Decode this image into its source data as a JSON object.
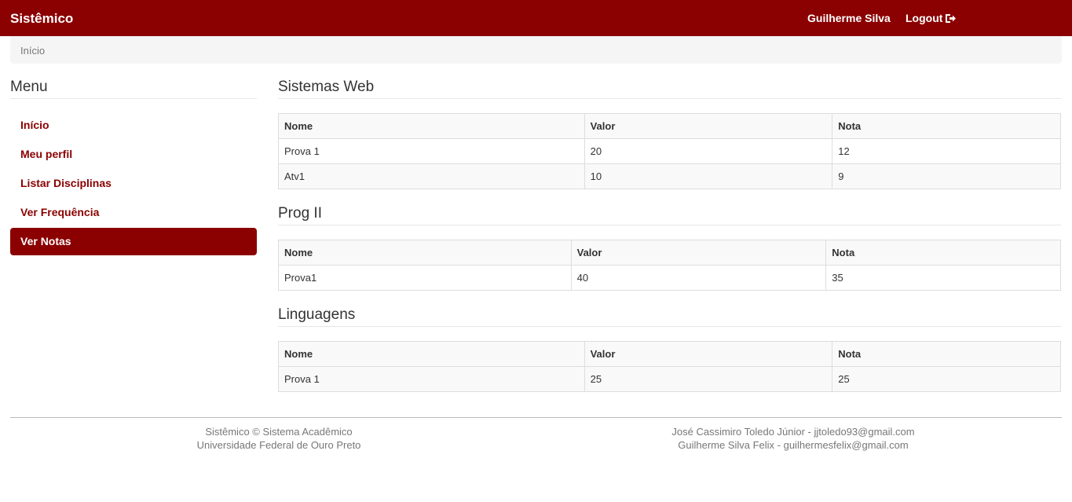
{
  "navbar": {
    "brand": "Sistêmico",
    "user": "Guilherme Silva",
    "logout": "Logout",
    "logout_icon": "logout-icon"
  },
  "breadcrumb": {
    "current": "Início"
  },
  "sidebar": {
    "title": "Menu",
    "items": [
      {
        "label": "Início"
      },
      {
        "label": "Meu perfil"
      },
      {
        "label": "Listar Disciplinas"
      },
      {
        "label": "Ver Frequência"
      },
      {
        "label": "Ver Notas",
        "active": true
      }
    ]
  },
  "sections": [
    {
      "title": "Sistemas Web",
      "headers": [
        "Nome",
        "Valor",
        "Nota"
      ],
      "rows": [
        [
          "Prova 1",
          "20",
          "12"
        ],
        [
          "Atv1",
          "10",
          "9"
        ]
      ]
    },
    {
      "title": "Prog II",
      "headers": [
        "Nome",
        "Valor",
        "Nota"
      ],
      "rows": [
        [
          "Prova1",
          "40",
          "35"
        ]
      ]
    },
    {
      "title": "Linguagens",
      "headers": [
        "Nome",
        "Valor",
        "Nota"
      ],
      "rows": [
        [
          "Prova 1",
          "25",
          "25"
        ]
      ]
    }
  ],
  "footer": {
    "left_line1": "Sistêmico © Sistema Acadêmico",
    "left_line2": "Universidade Federal de Ouro Preto",
    "right_line1": "José Cassimiro Toledo Júnior - jjtoledo93@gmail.com",
    "right_line2": "Guilherme Silva Felix - guilhermesfelix@gmail.com"
  },
  "colors": {
    "primary": "#8b0000",
    "breadcrumb_bg": "#f5f5f5",
    "table_stripe": "#f9f9f9",
    "table_border": "#dddddd"
  }
}
